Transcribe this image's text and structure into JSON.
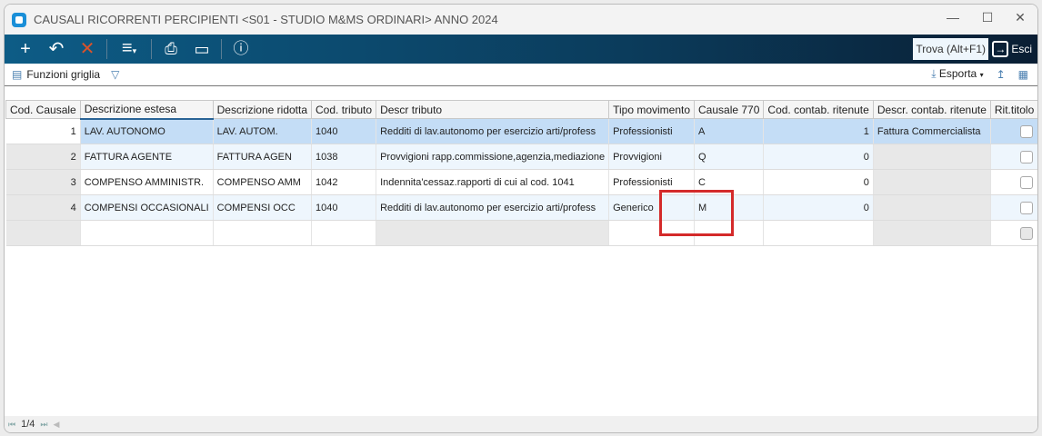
{
  "window": {
    "title": "CAUSALI RICORRENTI PERCIPIENTI <S01 - STUDIO M&MS ORDINARI> ANNO 2024"
  },
  "toolbar": {
    "search_label": "Trova (Alt+F1)",
    "exit_label": "Esci"
  },
  "subbar": {
    "grid_functions": "Funzioni griglia",
    "export": "Esporta"
  },
  "grid": {
    "columns": [
      "Cod. Causale",
      "Descrizione estesa",
      "Descrizione ridotta",
      "Cod. tributo",
      "Descr tributo",
      "Tipo movimento",
      "Causale 770",
      "Cod. contab. ritenute",
      "Descr. contab. ritenute",
      "Rit.titolo imp."
    ],
    "rows": [
      [
        "1",
        "LAV. AUTONOMO",
        "LAV. AUTOM.",
        "1040",
        "Redditi di lav.autonomo per esercizio arti/profess",
        "Professionisti",
        "A",
        "1",
        "Fattura Commercialista"
      ],
      [
        "2",
        "FATTURA AGENTE",
        "FATTURA AGEN",
        "1038",
        "Provvigioni rapp.commissione,agenzia,mediazione",
        "Provvigioni",
        "Q",
        "0",
        ""
      ],
      [
        "3",
        "COMPENSO AMMINISTR.",
        "COMPENSO AMM",
        "1042",
        "Indennita'cessaz.rapporti di cui al cod. 1041",
        "Professionisti",
        "C",
        "0",
        ""
      ],
      [
        "4",
        "COMPENSI OCCASIONALI",
        "COMPENSI OCC",
        "1040",
        "Redditi di lav.autonomo per esercizio arti/profess",
        "Generico",
        "M",
        "0",
        ""
      ]
    ],
    "rit_titolo_checked": [
      false,
      false,
      false,
      false
    ]
  },
  "footer": {
    "page": "1/4"
  },
  "colors": {
    "highlight": "#d42a2a",
    "selected_row": "#c4ddf6"
  }
}
